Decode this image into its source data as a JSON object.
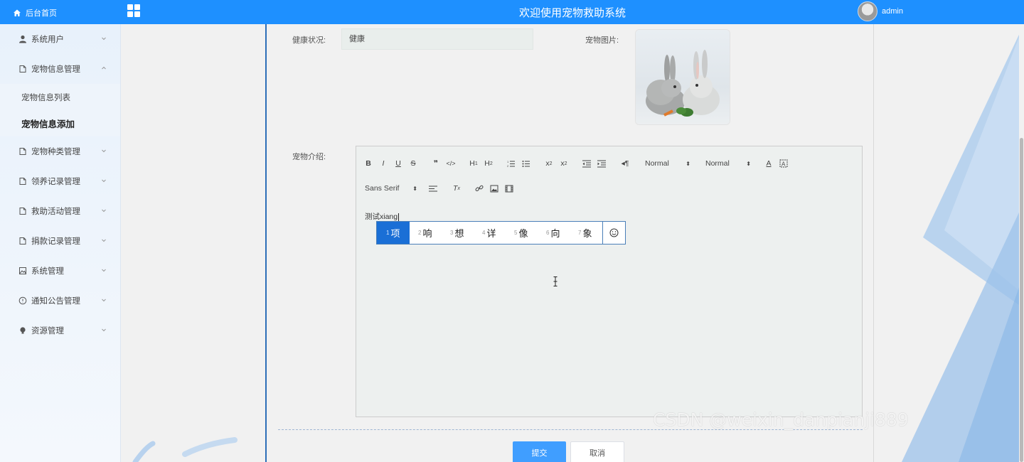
{
  "header": {
    "home_label": "后台首页",
    "title": "欢迎使用宠物救助系统",
    "username": "admin"
  },
  "sidebar": {
    "items": [
      {
        "label": "系统用户",
        "icon": "user-icon",
        "expanded": false
      },
      {
        "label": "宠物信息管理",
        "icon": "doc-icon",
        "expanded": true,
        "children": [
          {
            "label": "宠物信息列表",
            "active": false
          },
          {
            "label": "宠物信息添加",
            "active": true
          }
        ]
      },
      {
        "label": "宠物种类管理",
        "icon": "doc-icon",
        "expanded": false
      },
      {
        "label": "领养记录管理",
        "icon": "doc-icon",
        "expanded": false
      },
      {
        "label": "救助活动管理",
        "icon": "doc-icon",
        "expanded": false
      },
      {
        "label": "捐款记录管理",
        "icon": "doc-icon",
        "expanded": false
      },
      {
        "label": "系统管理",
        "icon": "picture-icon",
        "expanded": false
      },
      {
        "label": "通知公告管理",
        "icon": "info-circle-icon",
        "expanded": false
      },
      {
        "label": "资源管理",
        "icon": "bulb-icon",
        "expanded": false
      }
    ]
  },
  "form": {
    "health_label": "健康状况:",
    "health_value": "健康",
    "photo_label": "宠物图片:",
    "intro_label": "宠物介绍:",
    "editor": {
      "header_select": "Normal",
      "size_select": "Normal",
      "font_select": "Sans Serif",
      "text": "测试xiang"
    },
    "ime": {
      "candidates": [
        {
          "num": "1",
          "text": "项"
        },
        {
          "num": "2",
          "text": "响"
        },
        {
          "num": "3",
          "text": "想"
        },
        {
          "num": "4",
          "text": "详"
        },
        {
          "num": "5",
          "text": "像"
        },
        {
          "num": "6",
          "text": "向"
        },
        {
          "num": "7",
          "text": "象"
        }
      ]
    },
    "submit_label": "提交",
    "cancel_label": "取消"
  },
  "watermark": "CSDN @weixin_danpianji889",
  "colors": {
    "primary": "#1e90ff",
    "button": "#409eff",
    "ime_selected": "#1a6fd6"
  }
}
